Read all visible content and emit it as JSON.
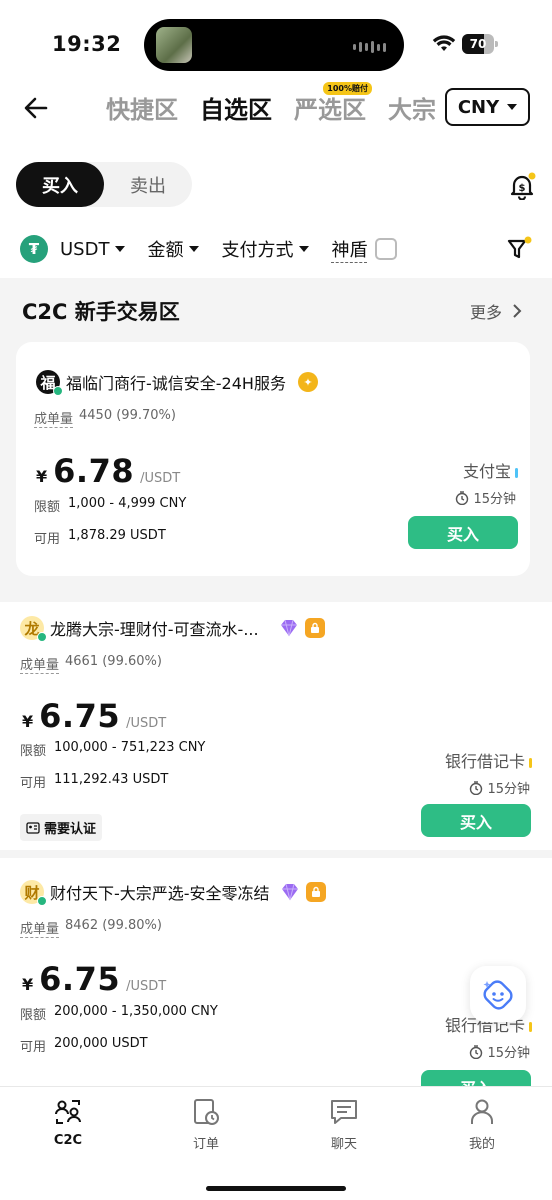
{
  "status_bar": {
    "time": "19:32",
    "battery": "70",
    "battery_level": 0.7
  },
  "header": {
    "tabs": [
      {
        "label": "快捷区",
        "active": false
      },
      {
        "label": "自选区",
        "active": true
      },
      {
        "label": "严选区",
        "active": false,
        "badge": "100%赔付"
      },
      {
        "label": "大宗",
        "active": false
      }
    ],
    "currency": "CNY"
  },
  "toggle": {
    "buy": "买入",
    "sell": "卖出"
  },
  "filters": {
    "coin": "USDT",
    "coin_symbol": "₮",
    "amount": "金额",
    "payment": "支付方式",
    "shield": "神盾"
  },
  "section": {
    "title": "C2C 新手交易区",
    "more": "更多"
  },
  "listings": [
    {
      "avatar": "福",
      "avatar_bg": "#111111",
      "avatar_fg": "#ffffff",
      "name": "福临门商行-诚信安全-24H服务",
      "stat_label": "成单量",
      "stat_value": "4450 (99.70%)",
      "currency_symbol": "¥",
      "price": "6.78",
      "unit": "/USDT",
      "limit_label": "限额",
      "limit": "1,000 - 4,999 CNY",
      "avail_label": "可用",
      "available": "1,878.29 USDT",
      "payment": "支付宝",
      "payment_color": "#4fc3f7",
      "time": "15分钟",
      "action": "买入"
    },
    {
      "avatar": "龙",
      "avatar_bg": "#fde9a6",
      "avatar_fg": "#b07a00",
      "name": "龙腾大宗-理财付-可查流水-...",
      "stat_label": "成单量",
      "stat_value": "4661 (99.60%)",
      "currency_symbol": "¥",
      "price": "6.75",
      "unit": "/USDT",
      "limit_label": "限额",
      "limit": "100,000 - 751,223 CNY",
      "avail_label": "可用",
      "available": "111,292.43 USDT",
      "payment": "银行借记卡",
      "payment_color": "#f5c518",
      "time": "15分钟",
      "action": "买入",
      "verify": "需要认证"
    },
    {
      "avatar": "财",
      "avatar_bg": "#fde9a6",
      "avatar_fg": "#b07a00",
      "name": "财付天下-大宗严选-安全零冻结",
      "stat_label": "成单量",
      "stat_value": "8462 (99.80%)",
      "currency_symbol": "¥",
      "price": "6.75",
      "unit": "/USDT",
      "limit_label": "限额",
      "limit": "200,000 - 1,350,000 CNY",
      "avail_label": "可用",
      "available": "200,000 USDT",
      "payment": "银行借记卡",
      "payment_color": "#f5c518",
      "time": "15分钟",
      "action": "买入"
    }
  ],
  "bottom_nav": [
    {
      "label": "C2C",
      "icon": "c2c-users-icon",
      "active": true
    },
    {
      "label": "订单",
      "icon": "orders-icon",
      "active": false
    },
    {
      "label": "聊天",
      "icon": "chat-icon",
      "active": false
    },
    {
      "label": "我的",
      "icon": "profile-icon",
      "active": false
    }
  ],
  "colors": {
    "buy_green": "#2ebd85",
    "accent_yellow": "#f5c518",
    "usdt_green": "#26a17b"
  }
}
